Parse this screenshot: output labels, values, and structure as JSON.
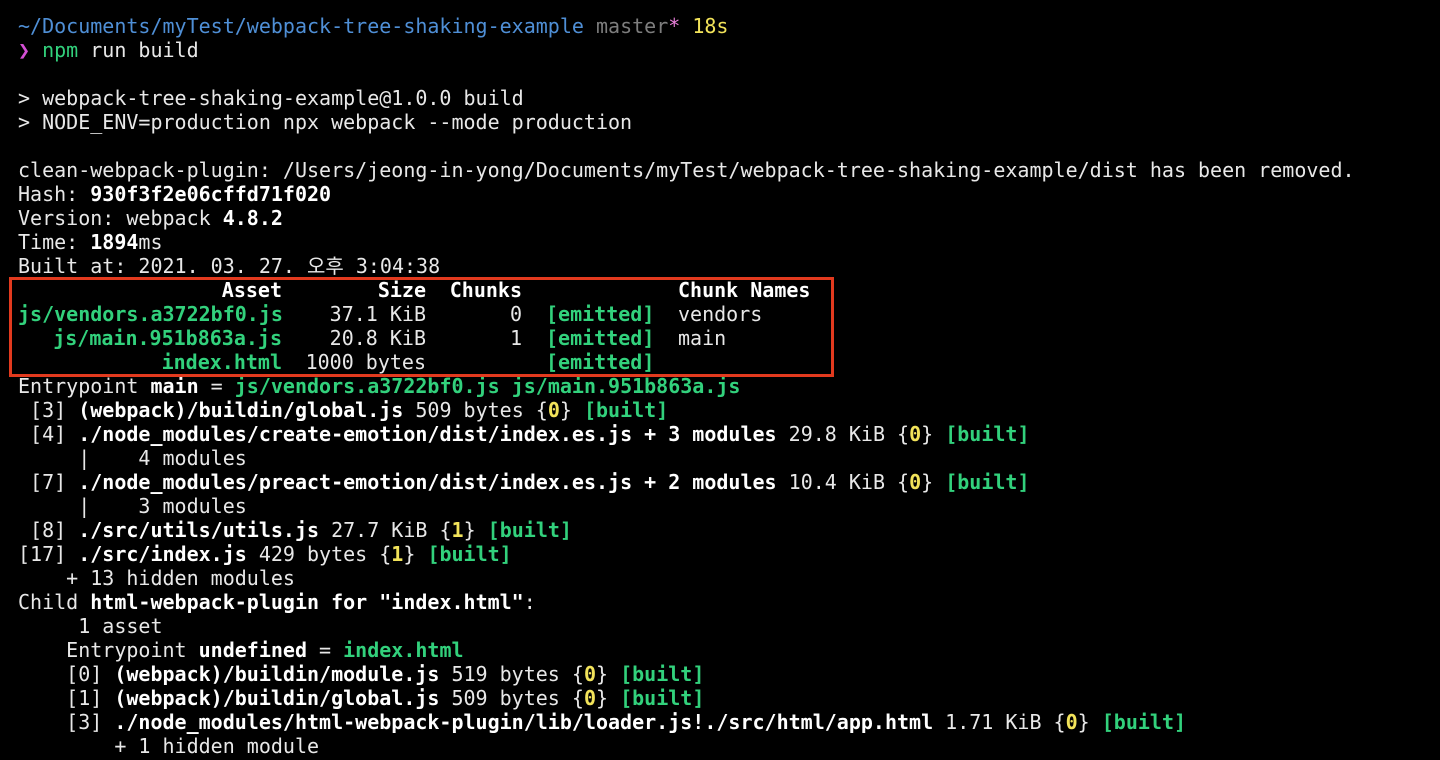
{
  "prompt": {
    "path": "~/Documents/myTest/webpack-tree-shaking-example",
    "branch": "master",
    "dirty": "*",
    "duration": "18s",
    "symbol": "❯",
    "command_bin": "npm",
    "command_args": "run build"
  },
  "script": {
    "line1": "> webpack-tree-shaking-example@1.0.0 build",
    "line2": "> NODE_ENV=production npx webpack --mode production"
  },
  "clean_msg": "clean-webpack-plugin: /Users/jeong-in-yong/Documents/myTest/webpack-tree-shaking-example/dist has been removed.",
  "build_info": {
    "hash_label": "Hash: ",
    "hash": "930f3f2e06cffd71f020",
    "version_label": "Version: webpack ",
    "version": "4.8.2",
    "time_label": "Time: ",
    "time": "1894",
    "time_unit": "ms",
    "built_at": "Built at: 2021. 03. 27. 오후 3:04:38"
  },
  "asset_table": {
    "header": {
      "asset": "Asset",
      "size": "Size",
      "chunks": "Chunks",
      "chunk_names": "Chunk Names"
    },
    "rows": [
      {
        "asset": "js/vendors.a3722bf0.js",
        "size": "37.1 KiB",
        "chunks": "0",
        "status": "[emitted]",
        "name": "vendors"
      },
      {
        "asset": "js/main.951b863a.js",
        "size": "20.8 KiB",
        "chunks": "1",
        "status": "[emitted]",
        "name": "main"
      },
      {
        "asset": "index.html",
        "size": "1000 bytes",
        "chunks": "",
        "status": "[emitted]",
        "name": ""
      }
    ]
  },
  "entrypoint": {
    "label": "Entrypoint ",
    "name": "main",
    "eq": " = ",
    "files": "js/vendors.a3722bf0.js js/main.951b863a.js"
  },
  "modules": [
    {
      "id": " [3] ",
      "path": "(webpack)/buildin/global.js",
      "size": " 509 bytes ",
      "chunk": "0",
      "status": "[built]"
    },
    {
      "id": " [4] ",
      "path": "./node_modules/create-emotion/dist/index.es.js + 3 modules",
      "size": " 29.8 KiB ",
      "chunk": "0",
      "status": "[built]",
      "sub": "     |    4 modules"
    },
    {
      "id": " [7] ",
      "path": "./node_modules/preact-emotion/dist/index.es.js + 2 modules",
      "size": " 10.4 KiB ",
      "chunk": "0",
      "status": "[built]",
      "sub": "     |    3 modules"
    },
    {
      "id": " [8] ",
      "path": "./src/utils/utils.js",
      "size": " 27.7 KiB ",
      "chunk": "1",
      "status": "[built]"
    },
    {
      "id": "[17] ",
      "path": "./src/index.js",
      "size": " 429 bytes ",
      "chunk": "1",
      "status": "[built]"
    }
  ],
  "hidden_modules": "    + 13 hidden modules",
  "child": {
    "label": "Child ",
    "name": "html-webpack-plugin for \"index.html\"",
    "colon": ":",
    "assets": "     1 asset",
    "entry_label": "    Entrypoint ",
    "entry_name": "undefined",
    "entry_eq": " = ",
    "entry_file": "index.html",
    "modules": [
      {
        "id": "    [0] ",
        "path": "(webpack)/buildin/module.js",
        "size": " 519 bytes ",
        "chunk": "0",
        "status": "[built]"
      },
      {
        "id": "    [1] ",
        "path": "(webpack)/buildin/global.js",
        "size": " 509 bytes ",
        "chunk": "0",
        "status": "[built]"
      },
      {
        "id": "    [3] ",
        "path": "./node_modules/html-webpack-plugin/lib/loader.js!./src/html/app.html",
        "size": " 1.71 KiB ",
        "chunk": "0",
        "status": "[built]"
      }
    ],
    "hidden": "        + 1 hidden module"
  }
}
